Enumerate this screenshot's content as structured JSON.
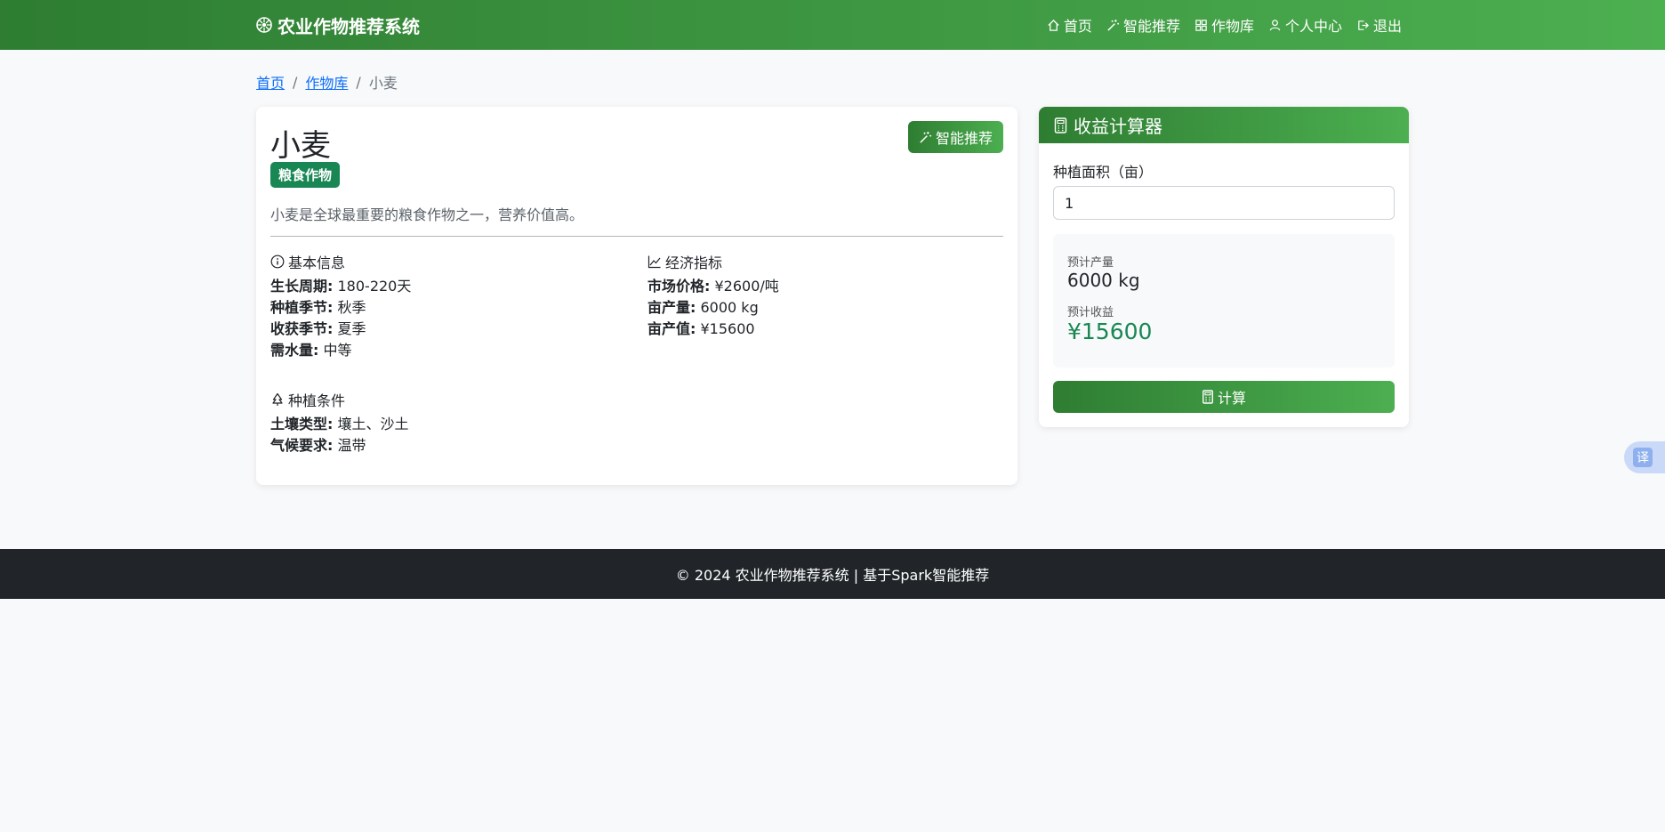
{
  "brand": {
    "name": "农业作物推荐系统",
    "icon": "flower-icon"
  },
  "nav": [
    {
      "label": "首页",
      "icon": "house-icon"
    },
    {
      "label": "智能推荐",
      "icon": "magic-wand-icon"
    },
    {
      "label": "作物库",
      "icon": "grid-icon"
    },
    {
      "label": "个人中心",
      "icon": "person-icon"
    },
    {
      "label": "退出",
      "icon": "logout-icon"
    }
  ],
  "breadcrumb": {
    "home": "首页",
    "library": "作物库",
    "current": "小麦",
    "separator": "/"
  },
  "crop": {
    "name": "小麦",
    "category": "粮食作物",
    "description": "小麦是全球最重要的粮食作物之一，营养价值高。",
    "smart_button": "智能推荐",
    "basic_title": "基本信息",
    "basic": [
      {
        "label": "生长周期:",
        "value": "180-220天"
      },
      {
        "label": "种植季节:",
        "value": "秋季"
      },
      {
        "label": "收获季节:",
        "value": "夏季"
      },
      {
        "label": "需水量:",
        "value": "中等"
      }
    ],
    "economic_title": "经济指标",
    "economic": [
      {
        "label": "市场价格:",
        "value": "¥2600/吨"
      },
      {
        "label": "亩产量:",
        "value": "6000 kg"
      },
      {
        "label": "亩产值:",
        "value": "¥15600"
      }
    ],
    "condition_title": "种植条件",
    "conditions": [
      {
        "label": "土壤类型:",
        "value": "壤土、沙土"
      },
      {
        "label": "气候要求:",
        "value": "温带"
      }
    ]
  },
  "calculator": {
    "title": "收益计算器",
    "area_label": "种植面积（亩）",
    "area_value": "1",
    "yield_label": "预计产量",
    "yield_value": "6000 kg",
    "income_label": "预计收益",
    "income_value": "¥15600",
    "button": "计算"
  },
  "translate_tab": "译",
  "footer": "© 2024 农业作物推荐系统 | 基于Spark智能推荐",
  "colors": {
    "primary_green": "#2e7d32",
    "light_green": "#4caf50",
    "badge": "#198754",
    "footer": "#212529"
  }
}
